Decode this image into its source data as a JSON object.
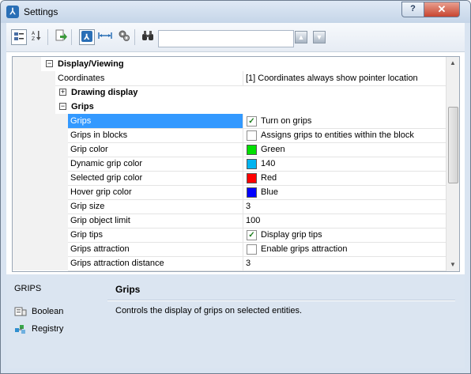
{
  "window": {
    "title": "Settings",
    "help_label": "?",
    "close_label": "✕"
  },
  "toolbar": {
    "search_value": "",
    "search_placeholder": ""
  },
  "tree": {
    "sections": [
      {
        "label": "Display/Viewing",
        "expander": "−"
      },
      {
        "label": "Drawing display",
        "expander": "+"
      },
      {
        "label": "Grips",
        "expander": "−"
      }
    ],
    "coordinates": {
      "name": "Coordinates",
      "value": "[1] Coordinates always show pointer location"
    },
    "rows": [
      {
        "name": "Grips",
        "value": "Turn on grips",
        "kind": "check",
        "checked": true,
        "selected": true
      },
      {
        "name": "Grips in blocks",
        "value": "Assigns grips to entities within the block",
        "kind": "check",
        "checked": false
      },
      {
        "name": "Grip color",
        "value": "Green",
        "kind": "color",
        "color": "#00e000"
      },
      {
        "name": "Dynamic grip color",
        "value": "140",
        "kind": "color",
        "color": "#00b4f0"
      },
      {
        "name": "Selected grip color",
        "value": "Red",
        "kind": "color",
        "color": "#ff0000"
      },
      {
        "name": "Hover grip color",
        "value": "Blue",
        "kind": "color",
        "color": "#0000ff"
      },
      {
        "name": "Grip size",
        "value": "3",
        "kind": "text"
      },
      {
        "name": "Grip object limit",
        "value": "100",
        "kind": "text"
      },
      {
        "name": "Grip tips",
        "value": "Display grip tips",
        "kind": "check",
        "checked": true
      },
      {
        "name": "Grips attraction",
        "value": "Enable grips attraction",
        "kind": "check",
        "checked": false
      },
      {
        "name": "Grips attraction distance",
        "value": "3",
        "kind": "text"
      }
    ]
  },
  "info": {
    "variable": "GRIPS",
    "type_label": "Boolean",
    "storage_label": "Registry",
    "title": "Grips",
    "description": "Controls the display of grips on selected entities."
  }
}
